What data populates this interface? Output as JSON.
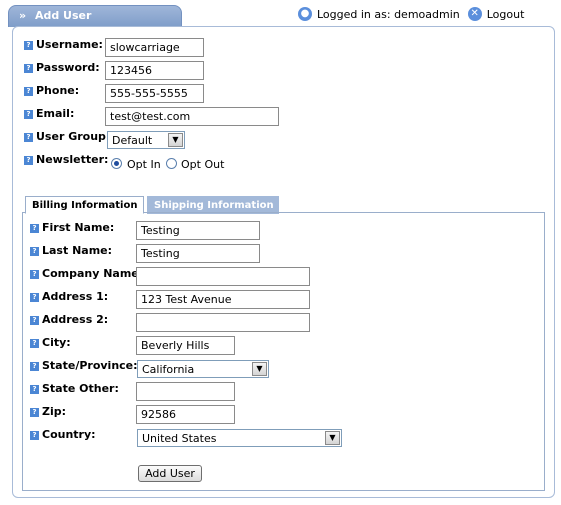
{
  "header": {
    "title": "Add User",
    "chevron": "»"
  },
  "topbar": {
    "logged_in_text": "Logged in as: demoadmin",
    "logout_label": "Logout",
    "user_icon": "user-icon",
    "logout_icon": "close-icon"
  },
  "account": {
    "username": {
      "label": "Username:",
      "value": "slowcarriage"
    },
    "password": {
      "label": "Password:",
      "value": "123456"
    },
    "phone": {
      "label": "Phone:",
      "value": "555-555-5555"
    },
    "email": {
      "label": "Email:",
      "value": "test@test.com"
    },
    "user_group": {
      "label": "User Group:",
      "value": "Default"
    },
    "newsletter": {
      "label": "Newsletter:",
      "opt_in": "Opt In",
      "opt_out": "Opt Out",
      "selected": "Opt In"
    }
  },
  "tabs": {
    "billing": "Billing Information",
    "shipping": "Shipping Information"
  },
  "billing": {
    "first_name": {
      "label": "First Name:",
      "value": "Testing"
    },
    "last_name": {
      "label": "Last Name:",
      "value": "Testing"
    },
    "company": {
      "label": "Company Name:",
      "value": ""
    },
    "address1": {
      "label": "Address 1:",
      "value": "123 Test Avenue"
    },
    "address2": {
      "label": "Address 2:",
      "value": ""
    },
    "city": {
      "label": "City:",
      "value": "Beverly Hills"
    },
    "state": {
      "label": "State/Province:",
      "value": "California"
    },
    "state_other": {
      "label": "State Other:",
      "value": ""
    },
    "zip": {
      "label": "Zip:",
      "value": "92586"
    },
    "country": {
      "label": "Country:",
      "value": "United States"
    }
  },
  "actions": {
    "add_user": "Add User"
  },
  "help_glyph": "?",
  "colors": {
    "accent": "#7f9dc9",
    "tab_inactive": "#a3b9d9",
    "help_icon": "#4b86d4"
  }
}
